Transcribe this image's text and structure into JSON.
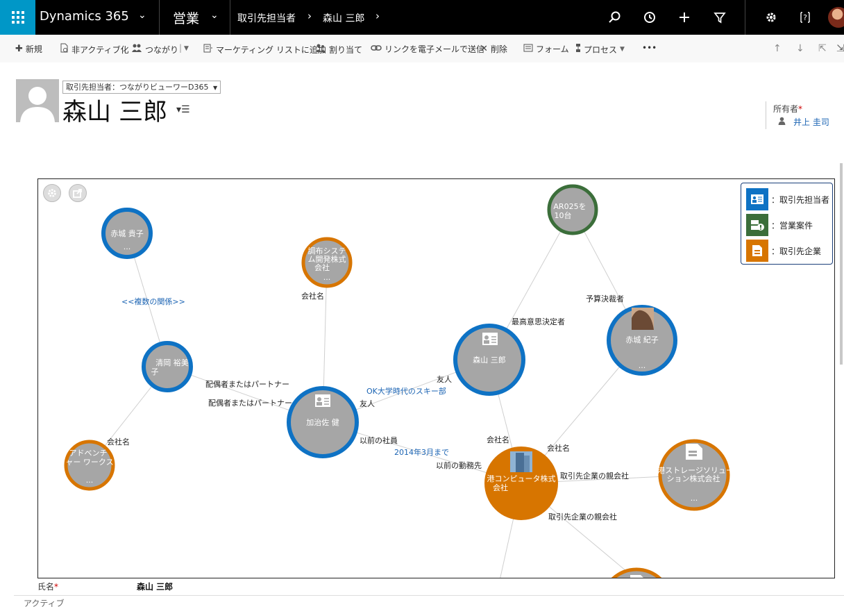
{
  "topbar": {
    "brand": "Dynamics 365",
    "area": "営業",
    "breadcrumb": [
      "取引先担当者",
      "森山 三郎"
    ]
  },
  "commands": {
    "new": "新規",
    "deactivate": "非アクティブ化",
    "connect": "つながり",
    "add_marketing_list": "マーケティング リストに追加",
    "assign": "割り当て",
    "email_link": "リンクを電子メールで送信",
    "delete": "削除",
    "form": "フォーム",
    "process": "プロセス",
    "more": "•••"
  },
  "header": {
    "form_selector": "取引先担当者：つながりビューワーD365",
    "record_name": "森山 三郎",
    "owner_label": "所有者",
    "owner_required": "*",
    "owner_value": "井上 圭司"
  },
  "colors": {
    "contact_ring": "#0e72c4",
    "account_ring": "#d77500",
    "opportunity_ring": "#3b6e3a",
    "node_fill": "#a6a6a6",
    "account_fill": "#d77500",
    "legend_contact": "#0e72c4",
    "legend_opportunity": "#3b6e3a",
    "legend_account": "#d77500"
  },
  "legend": {
    "contact": "：取引先担当者",
    "opportunity": "：営業案件",
    "account": "：取引先企業"
  },
  "graph": {
    "nodes": {
      "akagi_takako": {
        "line1": "赤城 貴子",
        "line2": "..."
      },
      "chofu": {
        "line1": "調布システ",
        "line2": "ム開発株式",
        "line3": "会社",
        "line4": "..."
      },
      "ar025": {
        "line1": "AR025を",
        "line2": "10台"
      },
      "kiyooka": {
        "line1": "清岡 裕美",
        "line2": "子"
      },
      "akagi_noriko": {
        "line1": "赤城 紀子",
        "line2": "..."
      },
      "moriyama": {
        "line1": "森山 三郎"
      },
      "kaji": {
        "line1": "加治佐 健"
      },
      "adventure": {
        "line1": "アドベンチ",
        "line2": "ャー ワークス",
        "line3": "..."
      },
      "minato_computer": {
        "line1": "港コンピュータ株式",
        "line2": "会社"
      },
      "minato_storage": {
        "line1": "港ストレージソリュー",
        "line2": "ション株式会社",
        "line3": "..."
      }
    },
    "edge_labels": {
      "multi_relation": "<<複数の関係>>",
      "company_name_chofu": "会社名",
      "top_decider": "最高意思決定者",
      "budget_approver": "予算決裁者",
      "spouse_1": "配偶者またはパートナー",
      "spouse_2": "配偶者またはパートナー",
      "friend_1": "友人",
      "ski_club": "OK大学時代のスキー部",
      "friend_2": "友人",
      "company_name_adv": "会社名",
      "former_employee": "以前の社員",
      "until_2014": "2014年3月まで",
      "former_workplace": "以前の勤務先",
      "company_name_moriyama": "会社名",
      "company_name_noriko": "会社名",
      "parent_company_1": "取引先企業の親会社",
      "parent_company_2": "取引先企業の親会社"
    }
  },
  "fields": {
    "name_label": "氏名",
    "name_required": "*",
    "name_value": "森山 三郎",
    "status_peek": "アクティブ"
  }
}
